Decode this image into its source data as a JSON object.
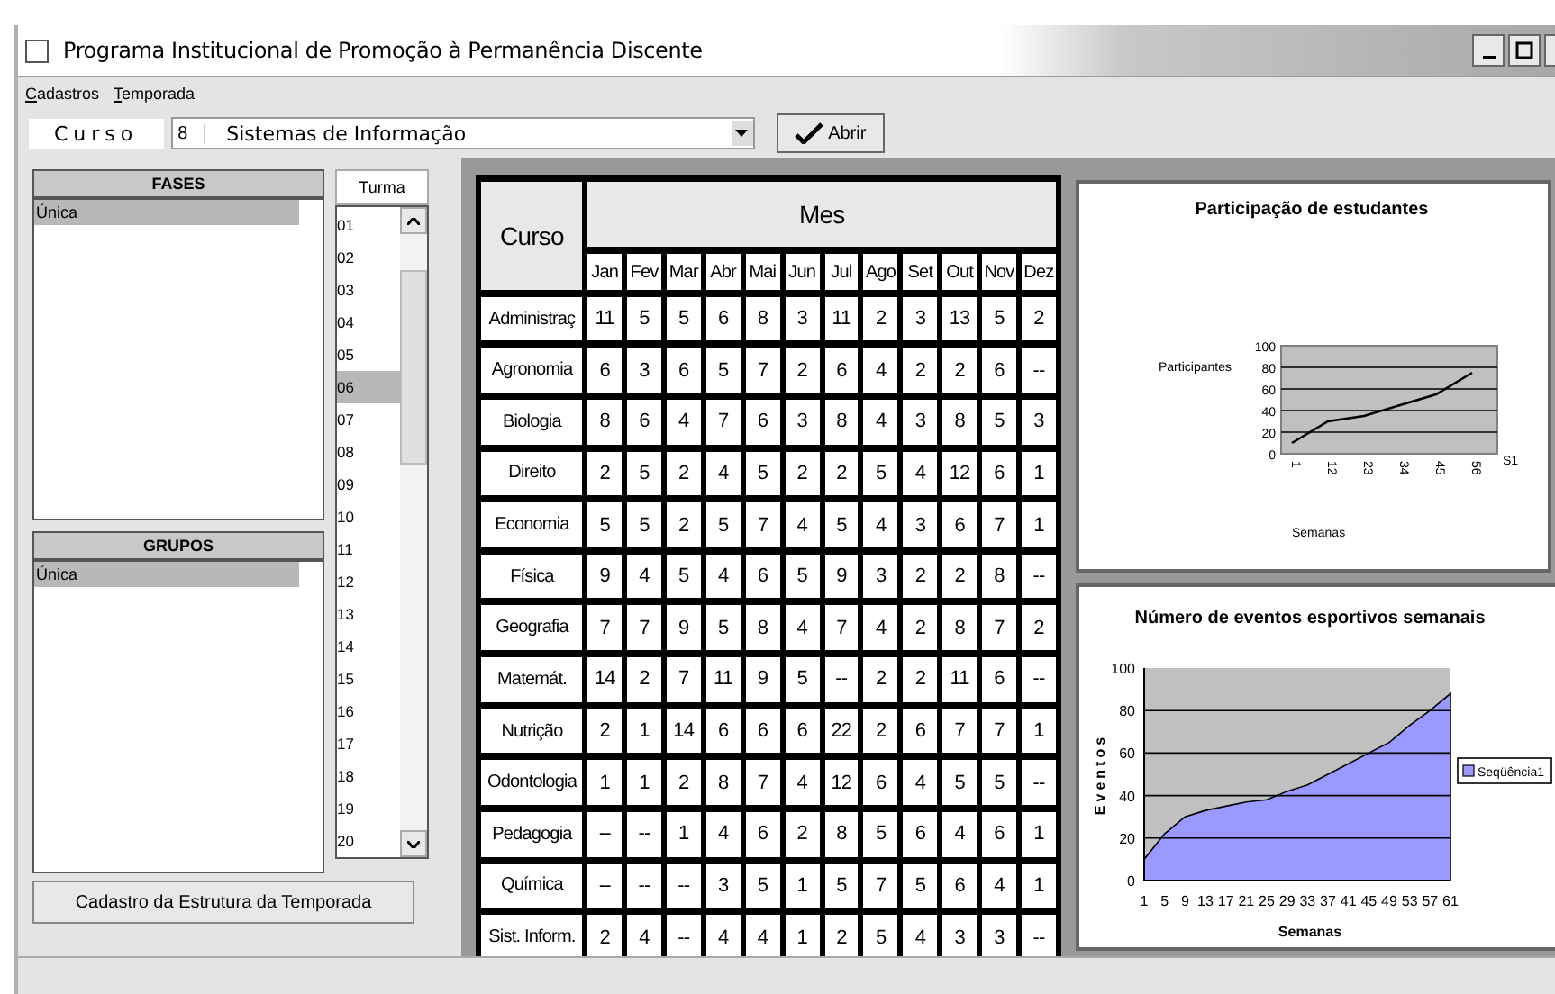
{
  "window": {
    "title": "Programa Institucional de Promoção à Permanência Discente"
  },
  "menu": [
    "Cadastros",
    "Temporada"
  ],
  "toolbar": {
    "label": "Curso",
    "code": "8",
    "course": "Sistemas de Informação",
    "button": "Abrir"
  },
  "fases": {
    "title": "FASES",
    "items": [
      {
        "label": "Única",
        "selected": true
      }
    ]
  },
  "grupos": {
    "title": "GRUPOS",
    "items": [
      {
        "label": "Única",
        "selected": true
      }
    ]
  },
  "turma": {
    "title": "Turma",
    "items": [
      {
        "label": "01",
        "selected": false
      },
      {
        "label": "02",
        "selected": false
      },
      {
        "label": "03",
        "selected": false
      },
      {
        "label": "04",
        "selected": false
      },
      {
        "label": "05",
        "selected": false
      },
      {
        "label": "06",
        "selected": true
      },
      {
        "label": "07",
        "selected": false
      },
      {
        "label": "08",
        "selected": false
      },
      {
        "label": "09",
        "selected": false
      },
      {
        "label": "10",
        "selected": false
      },
      {
        "label": "11",
        "selected": false
      },
      {
        "label": "12",
        "selected": false
      },
      {
        "label": "13",
        "selected": false
      },
      {
        "label": "14",
        "selected": false
      },
      {
        "label": "15",
        "selected": false
      },
      {
        "label": "16",
        "selected": false
      },
      {
        "label": "17",
        "selected": false
      },
      {
        "label": "18",
        "selected": false
      },
      {
        "label": "19",
        "selected": false
      },
      {
        "label": "20",
        "selected": false
      }
    ]
  },
  "footer_button": "Cadastro da Estrutura da Temporada",
  "table": {
    "corner": "Curso",
    "group": "Mes",
    "columns": [
      "Jan",
      "Fev",
      "Mar",
      "Abr",
      "Mai",
      "Jun",
      "Jul",
      "Ago",
      "Set",
      "Out",
      "Nov",
      "Dez"
    ],
    "rows": [
      {
        "course": "Administraç",
        "values": [
          "11",
          "5",
          "5",
          "6",
          "8",
          "3",
          "11",
          "2",
          "3",
          "13",
          "5",
          "2"
        ]
      },
      {
        "course": "Agronomia",
        "values": [
          "6",
          "3",
          "6",
          "5",
          "7",
          "2",
          "6",
          "4",
          "2",
          "2",
          "6",
          "--"
        ]
      },
      {
        "course": "Biologia",
        "values": [
          "8",
          "6",
          "4",
          "7",
          "6",
          "3",
          "8",
          "4",
          "3",
          "8",
          "5",
          "3"
        ]
      },
      {
        "course": "Direito",
        "values": [
          "2",
          "5",
          "2",
          "4",
          "5",
          "2",
          "2",
          "5",
          "4",
          "12",
          "6",
          "1"
        ]
      },
      {
        "course": "Economia",
        "values": [
          "5",
          "5",
          "2",
          "5",
          "7",
          "4",
          "5",
          "4",
          "3",
          "6",
          "7",
          "1"
        ]
      },
      {
        "course": "Física",
        "values": [
          "9",
          "4",
          "5",
          "4",
          "6",
          "5",
          "9",
          "3",
          "2",
          "2",
          "8",
          "--"
        ]
      },
      {
        "course": "Geografia",
        "values": [
          "7",
          "7",
          "9",
          "5",
          "8",
          "4",
          "7",
          "4",
          "2",
          "8",
          "7",
          "2"
        ]
      },
      {
        "course": "Matemát.",
        "values": [
          "14",
          "2",
          "7",
          "11",
          "9",
          "5",
          "--",
          "2",
          "2",
          "11",
          "6",
          "--"
        ]
      },
      {
        "course": "Nutrição",
        "values": [
          "2",
          "1",
          "14",
          "6",
          "6",
          "6",
          "22",
          "2",
          "6",
          "7",
          "7",
          "1"
        ]
      },
      {
        "course": "Odontologia",
        "values": [
          "1",
          "1",
          "2",
          "8",
          "7",
          "4",
          "12",
          "6",
          "4",
          "5",
          "5",
          "--"
        ]
      },
      {
        "course": "Pedagogia",
        "values": [
          "--",
          "--",
          "1",
          "4",
          "6",
          "2",
          "8",
          "5",
          "6",
          "4",
          "6",
          "1"
        ]
      },
      {
        "course": "Química",
        "values": [
          "--",
          "--",
          "--",
          "3",
          "5",
          "1",
          "5",
          "7",
          "5",
          "6",
          "4",
          "1"
        ]
      },
      {
        "course": "Sist. Inform.",
        "values": [
          "2",
          "4",
          "--",
          "4",
          "4",
          "1",
          "2",
          "5",
          "4",
          "3",
          "3",
          "--"
        ]
      }
    ]
  },
  "charts": [
    {
      "chart_data": {
        "type": "line",
        "title": "Participação de estudantes",
        "xlabel": "Semanas",
        "ylabel": "Participantes",
        "categories": [
          "1",
          "12",
          "23",
          "34",
          "45",
          "56"
        ],
        "series": [
          {
            "name": "S1",
            "color": "#000000",
            "values": [
              10,
              30,
              35,
              45,
              55,
              75
            ]
          }
        ],
        "ylim": [
          0,
          100
        ],
        "yticks": [
          0,
          20,
          40,
          60,
          80,
          100
        ],
        "grid": true
      }
    },
    {
      "chart_data": {
        "type": "area",
        "title": "Número de eventos esportivos semanais",
        "xlabel": "Semanas",
        "ylabel": "Eventos",
        "categories": [
          "1",
          "5",
          "9",
          "13",
          "17",
          "21",
          "25",
          "29",
          "33",
          "37",
          "41",
          "45",
          "49",
          "53",
          "57",
          "61"
        ],
        "series": [
          {
            "name": "Seqüência1",
            "color": "#9999ff",
            "values": [
              10,
              22,
              30,
              33,
              35,
              37,
              38,
              42,
              45,
              50,
              55,
              60,
              65,
              73,
              80,
              88
            ]
          }
        ],
        "ylim": [
          0,
          100
        ],
        "yticks": [
          0,
          20,
          40,
          60,
          80,
          100
        ],
        "grid": true
      }
    }
  ]
}
